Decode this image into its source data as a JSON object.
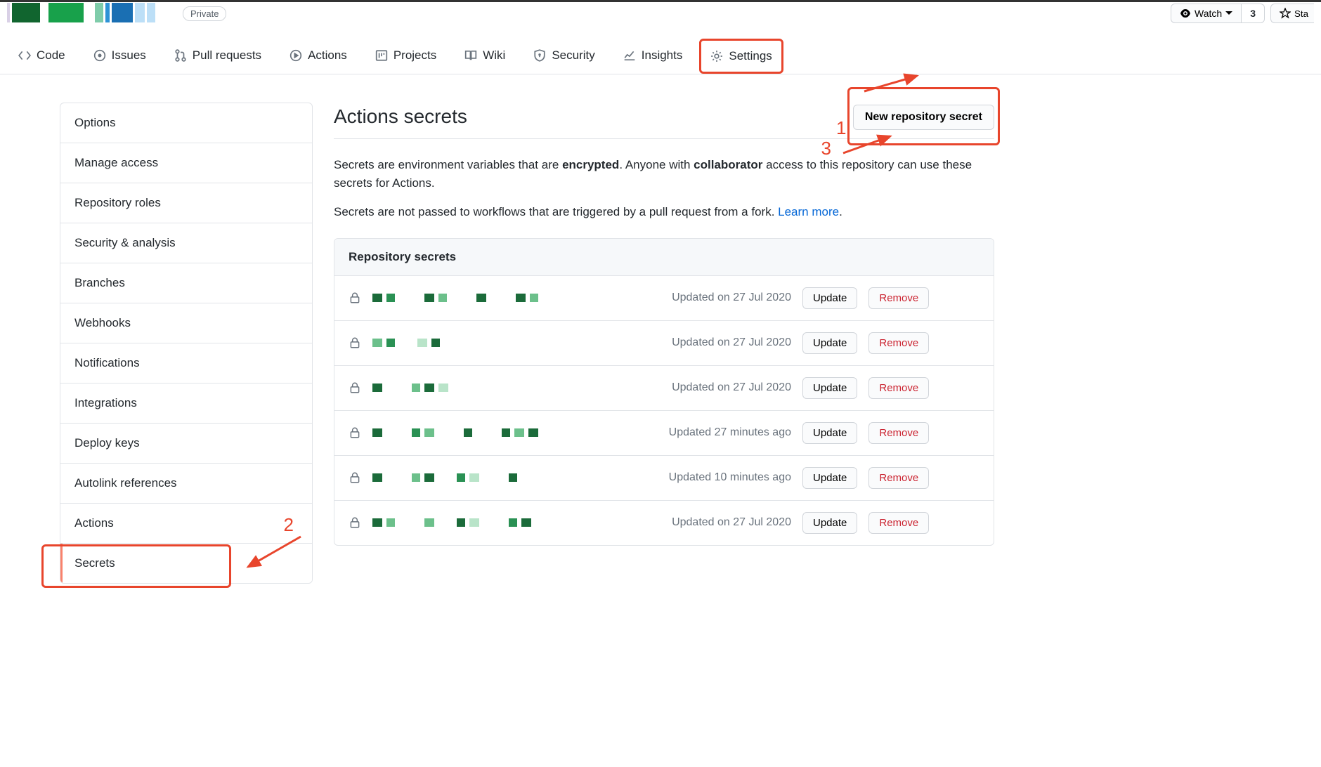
{
  "header": {
    "private_label": "Private",
    "watch_label": "Watch",
    "watch_count": "3",
    "star_label": "Sta"
  },
  "repo_nav": [
    {
      "label": "Code",
      "icon": "code"
    },
    {
      "label": "Issues",
      "icon": "issue"
    },
    {
      "label": "Pull requests",
      "icon": "pr"
    },
    {
      "label": "Actions",
      "icon": "play"
    },
    {
      "label": "Projects",
      "icon": "board"
    },
    {
      "label": "Wiki",
      "icon": "book"
    },
    {
      "label": "Security",
      "icon": "shield"
    },
    {
      "label": "Insights",
      "icon": "graph"
    },
    {
      "label": "Settings",
      "icon": "gear"
    }
  ],
  "sidebar": {
    "items": [
      "Options",
      "Manage access",
      "Repository roles",
      "Security & analysis",
      "Branches",
      "Webhooks",
      "Notifications",
      "Integrations",
      "Deploy keys",
      "Autolink references",
      "Actions",
      "Secrets"
    ]
  },
  "page": {
    "title": "Actions secrets",
    "new_secret_button": "New repository secret",
    "desc_part1": "Secrets are environment variables that are ",
    "desc_bold1": "encrypted",
    "desc_part2": ". Anyone with ",
    "desc_bold2": "collaborator",
    "desc_part3": " access to this repository can use these secrets for Actions.",
    "desc2_part1": "Secrets are not passed to workflows that are triggered by a pull request from a fork. ",
    "learn_more": "Learn more",
    "desc2_dot": "."
  },
  "secrets": {
    "header": "Repository secrets",
    "update_label": "Update",
    "remove_label": "Remove",
    "rows": [
      {
        "updated": "Updated on 27 Jul 2020"
      },
      {
        "updated": "Updated on 27 Jul 2020"
      },
      {
        "updated": "Updated on 27 Jul 2020"
      },
      {
        "updated": "Updated 27 minutes ago"
      },
      {
        "updated": "Updated 10 minutes ago"
      },
      {
        "updated": "Updated on 27 Jul 2020"
      }
    ]
  },
  "annotations": {
    "one": "1",
    "two": "2",
    "three": "3"
  }
}
